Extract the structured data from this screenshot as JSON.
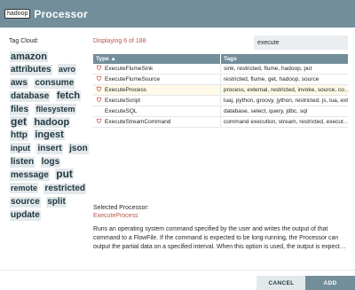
{
  "header": {
    "logo_text": "hadoop",
    "title": "Processor",
    "background": "#728e9b"
  },
  "tag_cloud": {
    "label": "Tag Cloud:",
    "tags": [
      {
        "text": "amazon",
        "size": 11
      },
      {
        "text": "attributes",
        "size": 10
      },
      {
        "text": "avro",
        "size": 9
      },
      {
        "text": "aws",
        "size": 10
      },
      {
        "text": "consume",
        "size": 10
      },
      {
        "text": "database",
        "size": 10
      },
      {
        "text": "fetch",
        "size": 11
      },
      {
        "text": "files",
        "size": 10
      },
      {
        "text": "filesystem",
        "size": 9
      },
      {
        "text": "get",
        "size": 12
      },
      {
        "text": "hadoop",
        "size": 11
      },
      {
        "text": "http",
        "size": 10
      },
      {
        "text": "ingest",
        "size": 11
      },
      {
        "text": "input",
        "size": 9
      },
      {
        "text": "insert",
        "size": 10
      },
      {
        "text": "json",
        "size": 10
      },
      {
        "text": "listen",
        "size": 10
      },
      {
        "text": "logs",
        "size": 10
      },
      {
        "text": "message",
        "size": 10
      },
      {
        "text": "put",
        "size": 12
      },
      {
        "text": "remote",
        "size": 9
      },
      {
        "text": "restricted",
        "size": 10
      },
      {
        "text": "source",
        "size": 10
      },
      {
        "text": "split",
        "size": 10
      },
      {
        "text": "update",
        "size": 10
      }
    ]
  },
  "results": {
    "displaying_text": "Displaying 6 of 188",
    "filter_value": "execute",
    "columns": {
      "type": "Type ▲",
      "tags": "Tags"
    },
    "rows": [
      {
        "type": "ExecuteFlumeSink",
        "tags": "sink, restricted, flume, hadoop, put",
        "restricted": true,
        "selected": false
      },
      {
        "type": "ExecuteFlumeSource",
        "tags": "restricted, flume, get, hadoop, source",
        "restricted": true,
        "selected": false
      },
      {
        "type": "ExecuteProcess",
        "tags": "process, external, restricted, invoke, source, co…",
        "restricted": true,
        "selected": true
      },
      {
        "type": "ExecuteScript",
        "tags": "luaj, python, groovy, jython, restricted, js, lua, ext…",
        "restricted": true,
        "selected": false
      },
      {
        "type": "ExecuteSQL",
        "tags": "database, select, query, jdbc, sql",
        "restricted": false,
        "selected": false
      },
      {
        "type": "ExecuteStreamCommand",
        "tags": "command execution, stream, restricted, execut…",
        "restricted": true,
        "selected": false
      }
    ]
  },
  "selected": {
    "label": "Selected Processor:",
    "name": "ExecuteProcess",
    "description": "Runs an operating system command specified by the user and writes the output of that command to a FlowFile. If the command is expected to be long-running, the Processor can output the partial data on a specified interval. When this option is used, the output is expect…"
  },
  "buttons": {
    "cancel": "CANCEL",
    "add": "ADD"
  },
  "colors": {
    "accent": "#728e9b",
    "highlight": "#ba554a",
    "tag_bg": "#e3e8eb",
    "selected_row": "#fffae8"
  }
}
